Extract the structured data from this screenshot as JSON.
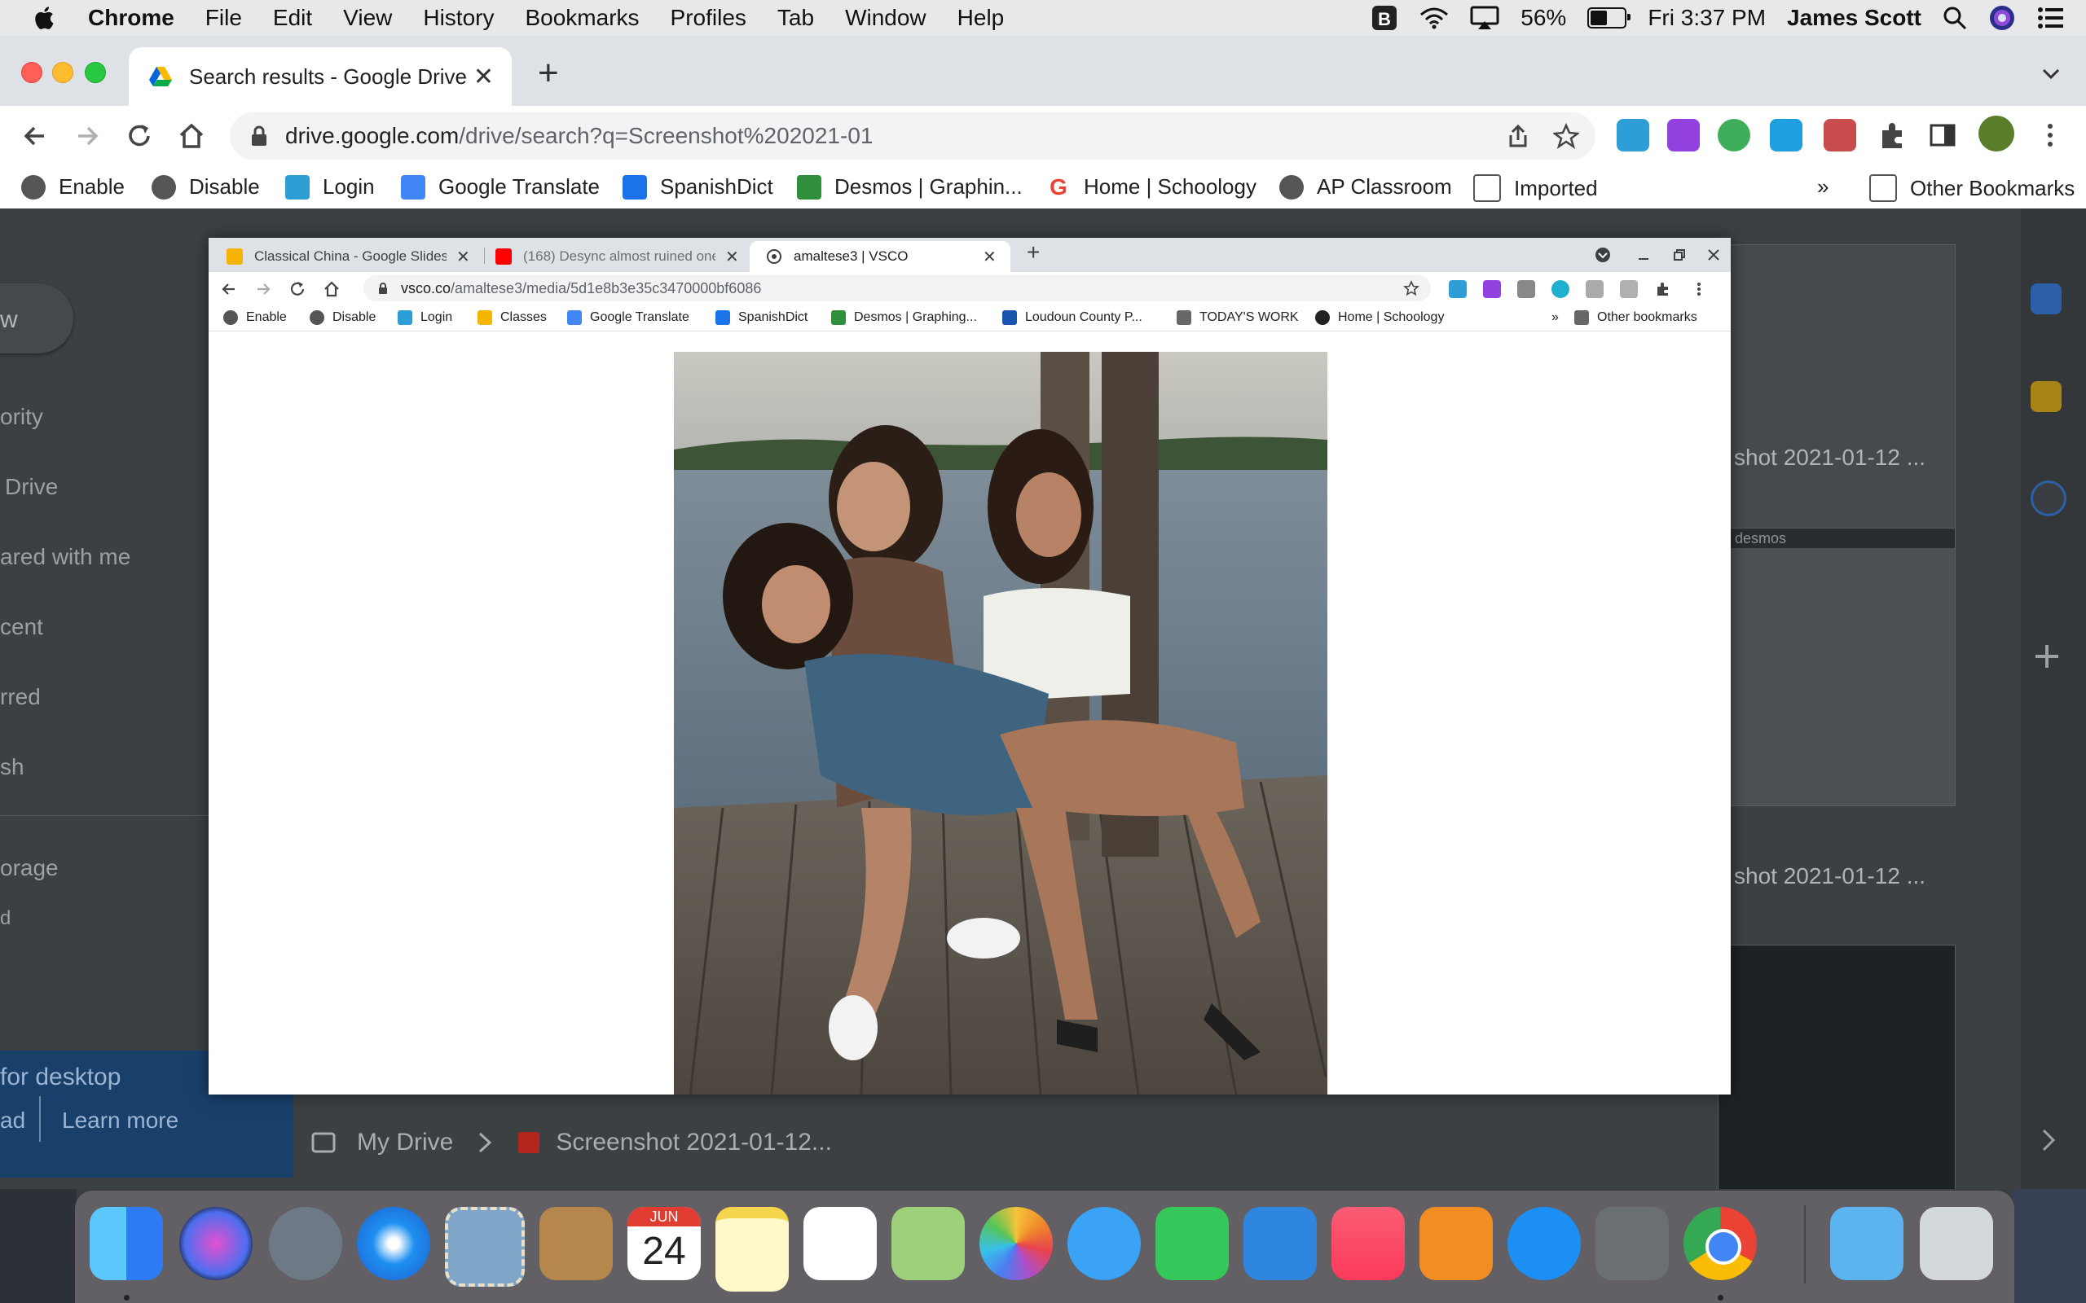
{
  "menubar": {
    "app": "Chrome",
    "items": [
      "File",
      "Edit",
      "View",
      "History",
      "Bookmarks",
      "Profiles",
      "Tab",
      "Window",
      "Help"
    ],
    "battery": "56%",
    "battery_level": 0.56,
    "clock": "Fri 3:37 PM",
    "user": "James Scott"
  },
  "outer": {
    "tab_title": "Search results - Google Drive",
    "url_host": "drive.google.com",
    "url_path": "/drive/search?q=Screenshot%202021-01",
    "bookmarks": [
      "Enable",
      "Disable",
      "Login",
      "Google Translate",
      "SpanishDict",
      "Desmos | Graphin...",
      "Home | Schoology",
      "AP Classroom",
      "Imported"
    ],
    "overflow": "»",
    "other_bookmarks": "Other Bookmarks"
  },
  "drive": {
    "new_label": "w",
    "nav": [
      "ority",
      "Drive",
      "ared with me",
      "cent",
      "rred",
      "sh"
    ],
    "storage": [
      "orage",
      "d"
    ],
    "promo_title": "for desktop",
    "promo_left": "ad",
    "promo_learn": "Learn more",
    "breadcrumb_root": "My Drive",
    "breadcrumb_file": "Screenshot 2021-01-12...",
    "card_title_1": "shot 2021-01-12 ...",
    "card_title_2": "shot 2021-01-12 ...",
    "card_thumb_label": "desmos"
  },
  "inner": {
    "tabs": [
      {
        "title": "Classical China - Google Slides",
        "color": "#f4b400"
      },
      {
        "title": "(168) Desync almost ruined one",
        "color": "#ff0000"
      },
      {
        "title": "amaltese3 | VSCO",
        "color": "#3c4043"
      }
    ],
    "url_host": "vsco.co",
    "url_path": "/amaltese3/media/5d1e8b3e35c3470000bf6086",
    "bookmarks": [
      "Enable",
      "Disable",
      "Login",
      "Classes",
      "Google Translate",
      "SpanishDict",
      "Desmos | Graphing...",
      "Loudoun County P...",
      "TODAY'S WORK",
      "Home | Schoology"
    ],
    "overflow": "»",
    "other_bookmarks": "Other bookmarks"
  },
  "dock": {
    "calendar_month": "JUN",
    "calendar_day": "24"
  }
}
